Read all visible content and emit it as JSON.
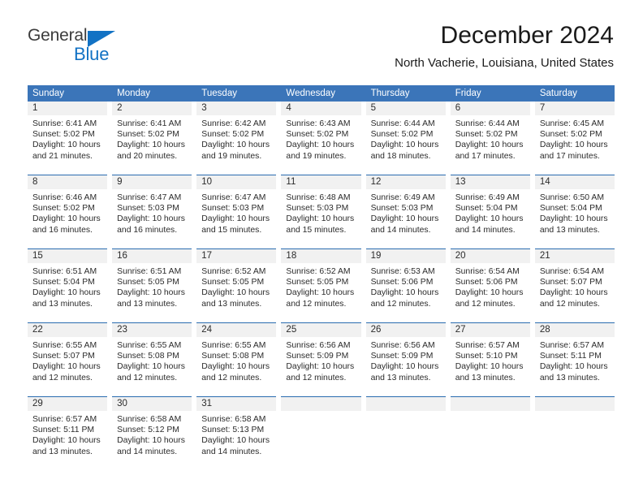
{
  "brand": {
    "name_part1": "General",
    "name_part2": "Blue",
    "logo_icon": "blue-triangle",
    "color_dark": "#3c3c3c",
    "color_blue": "#1272c4"
  },
  "header": {
    "title": "December 2024",
    "subtitle": "North Vacherie, Louisiana, United States"
  },
  "theme": {
    "header_blue": "#3b75b9",
    "separator_blue": "#2a6cb0",
    "daynum_band": "#f1f1f1"
  },
  "weekday_headers": [
    "Sunday",
    "Monday",
    "Tuesday",
    "Wednesday",
    "Thursday",
    "Friday",
    "Saturday"
  ],
  "weeks": [
    [
      {
        "day": "1",
        "sunrise": "Sunrise: 6:41 AM",
        "sunset": "Sunset: 5:02 PM",
        "daylight1": "Daylight: 10 hours",
        "daylight2": "and 21 minutes."
      },
      {
        "day": "2",
        "sunrise": "Sunrise: 6:41 AM",
        "sunset": "Sunset: 5:02 PM",
        "daylight1": "Daylight: 10 hours",
        "daylight2": "and 20 minutes."
      },
      {
        "day": "3",
        "sunrise": "Sunrise: 6:42 AM",
        "sunset": "Sunset: 5:02 PM",
        "daylight1": "Daylight: 10 hours",
        "daylight2": "and 19 minutes."
      },
      {
        "day": "4",
        "sunrise": "Sunrise: 6:43 AM",
        "sunset": "Sunset: 5:02 PM",
        "daylight1": "Daylight: 10 hours",
        "daylight2": "and 19 minutes."
      },
      {
        "day": "5",
        "sunrise": "Sunrise: 6:44 AM",
        "sunset": "Sunset: 5:02 PM",
        "daylight1": "Daylight: 10 hours",
        "daylight2": "and 18 minutes."
      },
      {
        "day": "6",
        "sunrise": "Sunrise: 6:44 AM",
        "sunset": "Sunset: 5:02 PM",
        "daylight1": "Daylight: 10 hours",
        "daylight2": "and 17 minutes."
      },
      {
        "day": "7",
        "sunrise": "Sunrise: 6:45 AM",
        "sunset": "Sunset: 5:02 PM",
        "daylight1": "Daylight: 10 hours",
        "daylight2": "and 17 minutes."
      }
    ],
    [
      {
        "day": "8",
        "sunrise": "Sunrise: 6:46 AM",
        "sunset": "Sunset: 5:02 PM",
        "daylight1": "Daylight: 10 hours",
        "daylight2": "and 16 minutes."
      },
      {
        "day": "9",
        "sunrise": "Sunrise: 6:47 AM",
        "sunset": "Sunset: 5:03 PM",
        "daylight1": "Daylight: 10 hours",
        "daylight2": "and 16 minutes."
      },
      {
        "day": "10",
        "sunrise": "Sunrise: 6:47 AM",
        "sunset": "Sunset: 5:03 PM",
        "daylight1": "Daylight: 10 hours",
        "daylight2": "and 15 minutes."
      },
      {
        "day": "11",
        "sunrise": "Sunrise: 6:48 AM",
        "sunset": "Sunset: 5:03 PM",
        "daylight1": "Daylight: 10 hours",
        "daylight2": "and 15 minutes."
      },
      {
        "day": "12",
        "sunrise": "Sunrise: 6:49 AM",
        "sunset": "Sunset: 5:03 PM",
        "daylight1": "Daylight: 10 hours",
        "daylight2": "and 14 minutes."
      },
      {
        "day": "13",
        "sunrise": "Sunrise: 6:49 AM",
        "sunset": "Sunset: 5:04 PM",
        "daylight1": "Daylight: 10 hours",
        "daylight2": "and 14 minutes."
      },
      {
        "day": "14",
        "sunrise": "Sunrise: 6:50 AM",
        "sunset": "Sunset: 5:04 PM",
        "daylight1": "Daylight: 10 hours",
        "daylight2": "and 13 minutes."
      }
    ],
    [
      {
        "day": "15",
        "sunrise": "Sunrise: 6:51 AM",
        "sunset": "Sunset: 5:04 PM",
        "daylight1": "Daylight: 10 hours",
        "daylight2": "and 13 minutes."
      },
      {
        "day": "16",
        "sunrise": "Sunrise: 6:51 AM",
        "sunset": "Sunset: 5:05 PM",
        "daylight1": "Daylight: 10 hours",
        "daylight2": "and 13 minutes."
      },
      {
        "day": "17",
        "sunrise": "Sunrise: 6:52 AM",
        "sunset": "Sunset: 5:05 PM",
        "daylight1": "Daylight: 10 hours",
        "daylight2": "and 13 minutes."
      },
      {
        "day": "18",
        "sunrise": "Sunrise: 6:52 AM",
        "sunset": "Sunset: 5:05 PM",
        "daylight1": "Daylight: 10 hours",
        "daylight2": "and 12 minutes."
      },
      {
        "day": "19",
        "sunrise": "Sunrise: 6:53 AM",
        "sunset": "Sunset: 5:06 PM",
        "daylight1": "Daylight: 10 hours",
        "daylight2": "and 12 minutes."
      },
      {
        "day": "20",
        "sunrise": "Sunrise: 6:54 AM",
        "sunset": "Sunset: 5:06 PM",
        "daylight1": "Daylight: 10 hours",
        "daylight2": "and 12 minutes."
      },
      {
        "day": "21",
        "sunrise": "Sunrise: 6:54 AM",
        "sunset": "Sunset: 5:07 PM",
        "daylight1": "Daylight: 10 hours",
        "daylight2": "and 12 minutes."
      }
    ],
    [
      {
        "day": "22",
        "sunrise": "Sunrise: 6:55 AM",
        "sunset": "Sunset: 5:07 PM",
        "daylight1": "Daylight: 10 hours",
        "daylight2": "and 12 minutes."
      },
      {
        "day": "23",
        "sunrise": "Sunrise: 6:55 AM",
        "sunset": "Sunset: 5:08 PM",
        "daylight1": "Daylight: 10 hours",
        "daylight2": "and 12 minutes."
      },
      {
        "day": "24",
        "sunrise": "Sunrise: 6:55 AM",
        "sunset": "Sunset: 5:08 PM",
        "daylight1": "Daylight: 10 hours",
        "daylight2": "and 12 minutes."
      },
      {
        "day": "25",
        "sunrise": "Sunrise: 6:56 AM",
        "sunset": "Sunset: 5:09 PM",
        "daylight1": "Daylight: 10 hours",
        "daylight2": "and 12 minutes."
      },
      {
        "day": "26",
        "sunrise": "Sunrise: 6:56 AM",
        "sunset": "Sunset: 5:09 PM",
        "daylight1": "Daylight: 10 hours",
        "daylight2": "and 13 minutes."
      },
      {
        "day": "27",
        "sunrise": "Sunrise: 6:57 AM",
        "sunset": "Sunset: 5:10 PM",
        "daylight1": "Daylight: 10 hours",
        "daylight2": "and 13 minutes."
      },
      {
        "day": "28",
        "sunrise": "Sunrise: 6:57 AM",
        "sunset": "Sunset: 5:11 PM",
        "daylight1": "Daylight: 10 hours",
        "daylight2": "and 13 minutes."
      }
    ],
    [
      {
        "day": "29",
        "sunrise": "Sunrise: 6:57 AM",
        "sunset": "Sunset: 5:11 PM",
        "daylight1": "Daylight: 10 hours",
        "daylight2": "and 13 minutes."
      },
      {
        "day": "30",
        "sunrise": "Sunrise: 6:58 AM",
        "sunset": "Sunset: 5:12 PM",
        "daylight1": "Daylight: 10 hours",
        "daylight2": "and 14 minutes."
      },
      {
        "day": "31",
        "sunrise": "Sunrise: 6:58 AM",
        "sunset": "Sunset: 5:13 PM",
        "daylight1": "Daylight: 10 hours",
        "daylight2": "and 14 minutes."
      },
      {
        "day": "",
        "sunrise": "",
        "sunset": "",
        "daylight1": "",
        "daylight2": ""
      },
      {
        "day": "",
        "sunrise": "",
        "sunset": "",
        "daylight1": "",
        "daylight2": ""
      },
      {
        "day": "",
        "sunrise": "",
        "sunset": "",
        "daylight1": "",
        "daylight2": ""
      },
      {
        "day": "",
        "sunrise": "",
        "sunset": "",
        "daylight1": "",
        "daylight2": ""
      }
    ]
  ]
}
